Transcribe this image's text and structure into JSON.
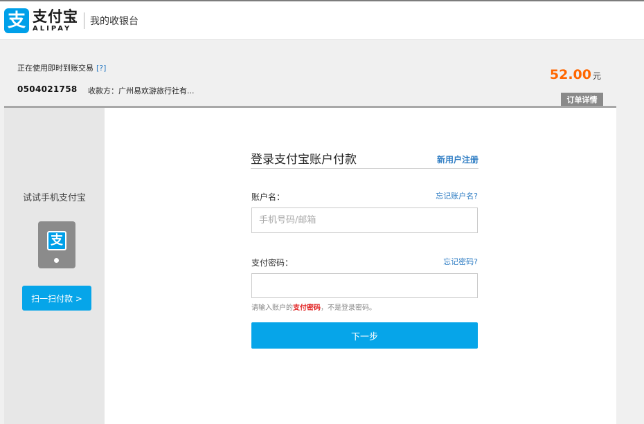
{
  "header": {
    "logo_mark": "支",
    "logo_cn": "支付宝",
    "logo_en": "ALIPAY",
    "subtitle": "我的收银台"
  },
  "order": {
    "type_text": "正在使用即时到账交易",
    "help_text": "[?]",
    "order_number": "0504021758",
    "payee_text": "收款方：广州易欢游旅行社有...",
    "amount": "52.00",
    "currency_unit": "元",
    "detail_button": "订单详情"
  },
  "left_panel": {
    "title": "试试手机支付宝",
    "phone_icon_glyph": "支",
    "scan_button": "扫一扫付款 >"
  },
  "login_form": {
    "title": "登录支付宝账户付款",
    "register_link": "新用户注册",
    "account_label": "账户名：",
    "forgot_account_link": "忘记账户名?",
    "account_placeholder": "手机号码/邮箱",
    "account_value": "",
    "password_label": "支付密码：",
    "forgot_password_link": "忘记密码?",
    "password_value": "",
    "hint_prefix": "请输入账户的",
    "hint_emphasis": "支付密码",
    "hint_suffix": "，不是登录密码。",
    "next_button": "下一步"
  },
  "colors": {
    "brand_blue": "#00a0e9",
    "button_blue": "#06a5e9",
    "link_blue": "#2d7cc3",
    "amount_orange": "#ff6600",
    "hint_red": "#e02020"
  }
}
